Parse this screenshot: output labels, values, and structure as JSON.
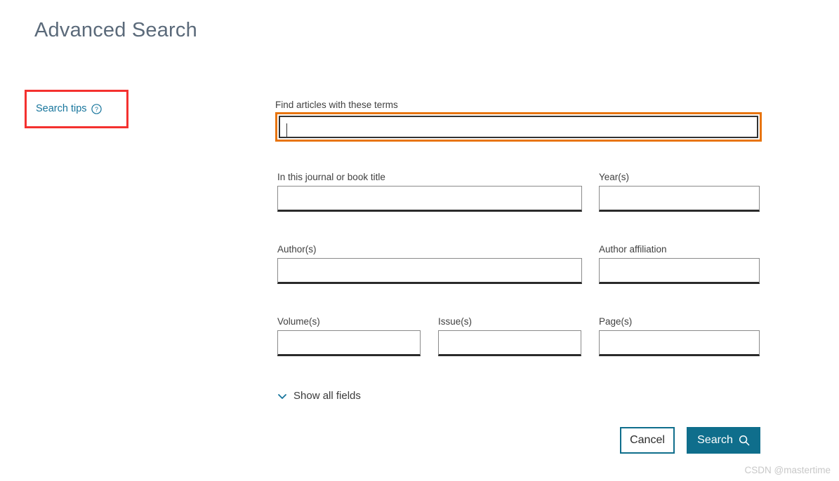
{
  "page": {
    "title": "Advanced Search"
  },
  "sidebar": {
    "search_tips": {
      "label": "Search tips",
      "icon": "help-circle-icon"
    }
  },
  "form": {
    "main_field": {
      "label": "Find articles with these terms",
      "value": "",
      "placeholder": "",
      "focused": true
    },
    "fields": [
      {
        "name": "journal_or_book_title",
        "label": "In this journal or book title",
        "value": "",
        "placeholder": ""
      },
      {
        "name": "years",
        "label": "Year(s)",
        "value": "",
        "placeholder": ""
      },
      {
        "name": "authors",
        "label": "Author(s)",
        "value": "",
        "placeholder": ""
      },
      {
        "name": "author_affiliation",
        "label": "Author affiliation",
        "value": "",
        "placeholder": ""
      },
      {
        "name": "volumes",
        "label": "Volume(s)",
        "value": "",
        "placeholder": ""
      },
      {
        "name": "issues",
        "label": "Issue(s)",
        "value": "",
        "placeholder": ""
      },
      {
        "name": "pages",
        "label": "Page(s)",
        "value": "",
        "placeholder": ""
      }
    ],
    "show_all_fields": {
      "label": "Show all fields",
      "icon": "chevron-down-icon"
    }
  },
  "actions": {
    "cancel_label": "Cancel",
    "search_label": "Search",
    "search_icon": "magnifier-icon"
  },
  "watermark": {
    "text": "CSDN @mastertime"
  },
  "colors": {
    "accent_teal": "#0f6e8c",
    "link_teal": "#17759c",
    "focus_orange": "#e8740c",
    "annotation_red": "#f4312f",
    "title_gray": "#5b6a7a"
  }
}
